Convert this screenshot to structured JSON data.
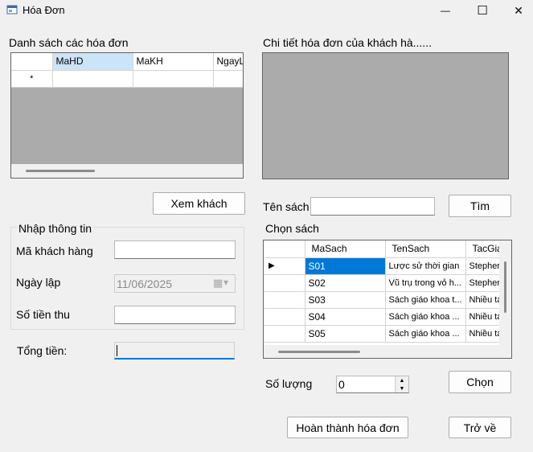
{
  "window": {
    "title": "Hóa Đơn",
    "minimize_glyph": "—",
    "maximize_glyph": "☐",
    "close_glyph": "✕"
  },
  "invoices": {
    "section_label": "Danh sách các hóa đơn",
    "columns": [
      "MaHD",
      "MaKH",
      "NgayL"
    ],
    "new_row_marker": "*"
  },
  "details": {
    "section_label": "Chi tiết hóa đơn của khách hà......"
  },
  "buttons": {
    "view_customer": "Xem khách",
    "search": "Tìm",
    "choose": "Chọn",
    "complete_invoice": "Hoàn thành hóa đơn",
    "back": "Trở về"
  },
  "input_group": {
    "title": "Nhập thông tin",
    "customer_code_label": "Mã khách hàng",
    "customer_code_value": "",
    "date_label": "Ngày lập",
    "date_value": "11/06/2025",
    "amount_paid_label": "Số tiền thu",
    "amount_paid_value": ""
  },
  "total": {
    "label": "Tổng tiền:",
    "value": ""
  },
  "book_search": {
    "label": "Tên sách",
    "value": ""
  },
  "books": {
    "section_label": "Chọn sách",
    "columns": [
      "MaSach",
      "TenSach",
      "TacGia"
    ],
    "current_row_marker": "▶",
    "rows": [
      {
        "ma": "S01",
        "ten": "Lược sử thời gian",
        "tacgia": "Stepher"
      },
      {
        "ma": "S02",
        "ten": "Vũ trụ trong vỏ h...",
        "tacgia": "Stepher"
      },
      {
        "ma": "S03",
        "ten": "Sách giáo khoa t...",
        "tacgia": "Nhiều tá"
      },
      {
        "ma": "S04",
        "ten": "Sách giáo khoa ...",
        "tacgia": "Nhiều tá"
      },
      {
        "ma": "S05",
        "ten": "Sách giáo khoa ...",
        "tacgia": "Nhiều tá"
      }
    ]
  },
  "quantity": {
    "label": "Số lượng",
    "value": "0"
  },
  "icons": {
    "up_arrow": "▲",
    "down_arrow": "▼",
    "calendar": "▦",
    "dropdown": "▾"
  }
}
